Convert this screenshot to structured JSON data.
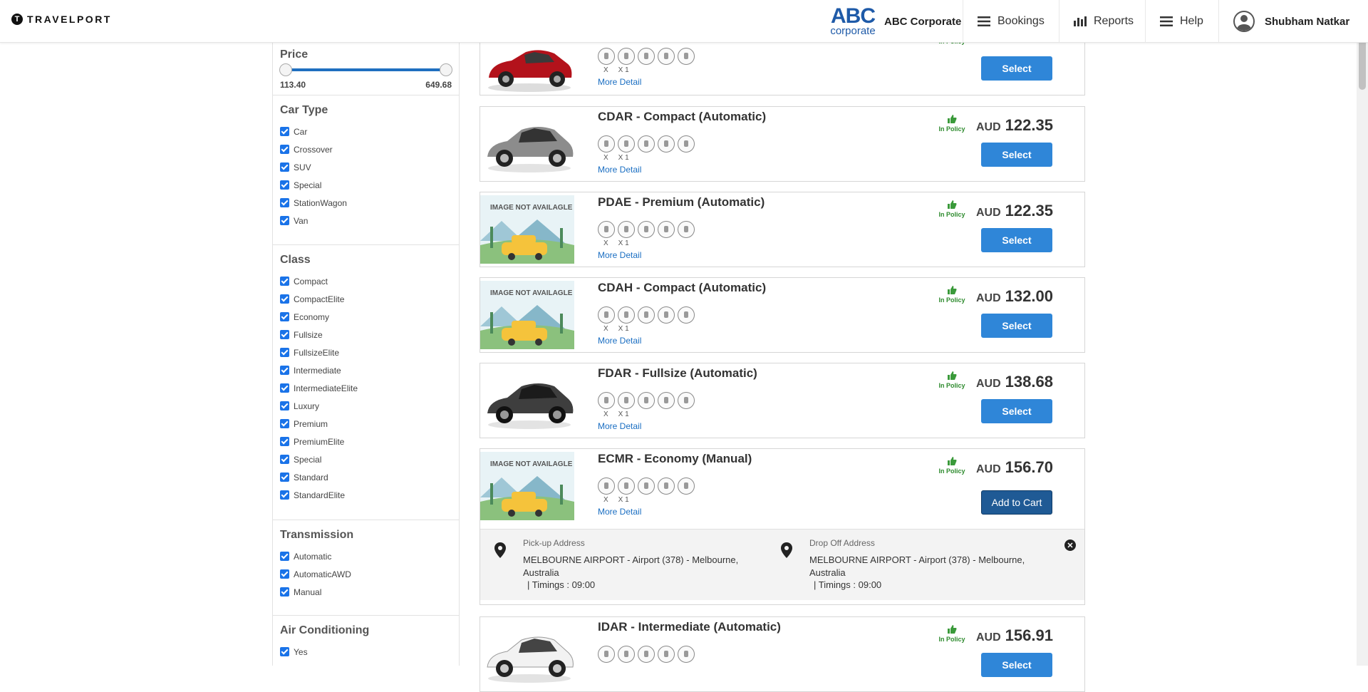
{
  "header": {
    "brand": "TRAVELPORT",
    "brand_mark": "T",
    "corp_logo_top": "ABC",
    "corp_logo_bottom": "corporate",
    "corp_name": "ABC Corporate",
    "nav": [
      {
        "label": "Bookings",
        "icon": "menu-icon"
      },
      {
        "label": "Reports",
        "icon": "bar-chart-icon"
      },
      {
        "label": "Help",
        "icon": "menu-icon"
      }
    ],
    "user_name": "Shubham Natkar"
  },
  "filters": {
    "price": {
      "title": "Price",
      "min": "113.40",
      "max": "649.68",
      "range_low": 0,
      "range_high": 1
    },
    "car_type": {
      "title": "Car Type",
      "items": [
        "Car",
        "Crossover",
        "SUV",
        "Special",
        "StationWagon",
        "Van"
      ]
    },
    "class": {
      "title": "Class",
      "items": [
        "Compact",
        "CompactElite",
        "Economy",
        "Fullsize",
        "FullsizeElite",
        "Intermediate",
        "IntermediateElite",
        "Luxury",
        "Premium",
        "PremiumElite",
        "Special",
        "Standard",
        "StandardElite"
      ]
    },
    "transmission": {
      "title": "Transmission",
      "items": [
        "Automatic",
        "AutomaticAWD",
        "Manual"
      ]
    },
    "air_conditioning": {
      "title": "Air Conditioning",
      "items": [
        "Yes"
      ]
    }
  },
  "common": {
    "more_detail": "More Detail",
    "in_policy": "In Policy",
    "select": "Select",
    "add_to_cart": "Add to Cart",
    "currency": "AUD",
    "count_x": "X",
    "count_x1": "X 1",
    "no_image": "IMAGE NOT AVAILAGLE"
  },
  "cars": [
    {
      "title": "",
      "price": "",
      "image": "red-sedan",
      "partial_top": true
    },
    {
      "title": "CDAR - Compact (Automatic)",
      "price": "122.35",
      "image": "silver-sedan"
    },
    {
      "title": "PDAE - Premium (Automatic)",
      "price": "122.35",
      "image": "no-image"
    },
    {
      "title": "CDAH - Compact (Automatic)",
      "price": "132.00",
      "image": "no-image"
    },
    {
      "title": "FDAR - Fullsize (Automatic)",
      "price": "138.68",
      "image": "dark-sedan"
    },
    {
      "title": "ECMR - Economy (Manual)",
      "price": "156.70",
      "image": "no-image",
      "expanded": true
    },
    {
      "title": "IDAR - Intermediate (Automatic)",
      "price": "156.91",
      "image": "white-sedan"
    }
  ],
  "expanded_details": {
    "pickup_label": "Pick-up Address",
    "pickup_value": "MELBOURNE AIRPORT - Airport (378) - Melbourne, Australia",
    "pickup_timing": "Timings : 09:00",
    "dropoff_label": "Drop Off Address",
    "dropoff_value": "MELBOURNE AIRPORT - Airport (378) - Melbourne, Australia",
    "dropoff_timing": "Timings : 09:00"
  }
}
